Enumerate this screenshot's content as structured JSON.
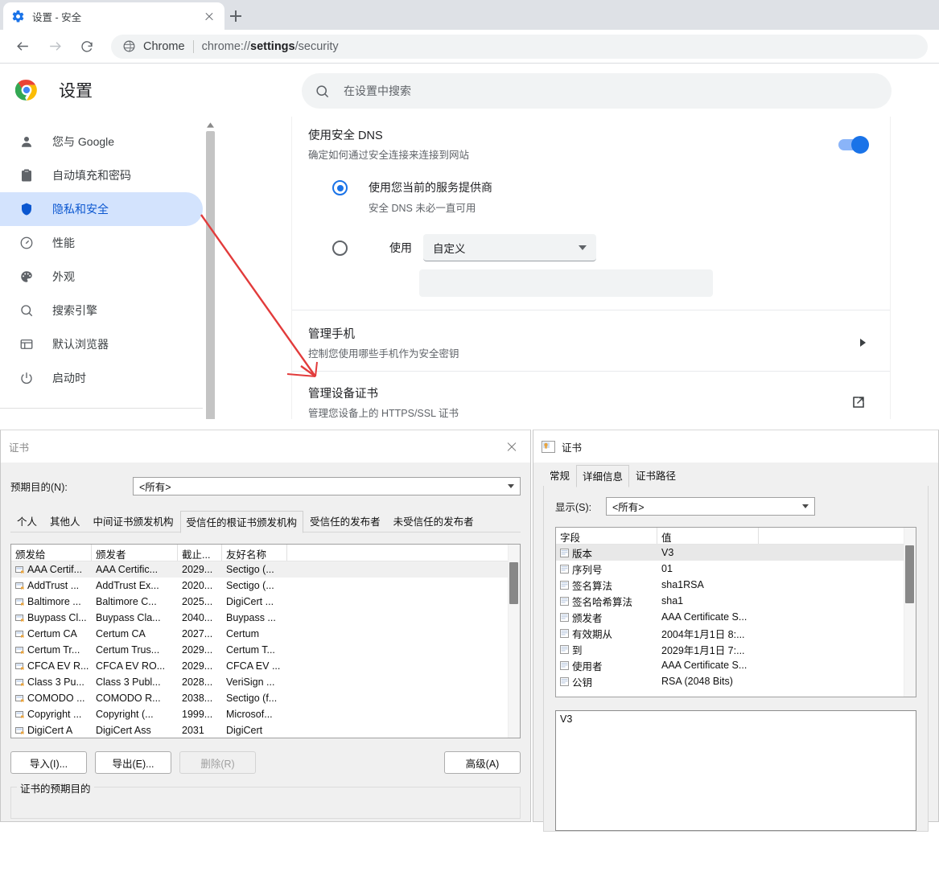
{
  "browser": {
    "tab": {
      "title": "设置 - 安全",
      "favicon_icon": "gear-icon",
      "close_icon": "close-icon"
    },
    "new_tab_label": "+",
    "back_icon": "back-arrow-icon",
    "forward_icon": "forward-arrow-icon",
    "reload_icon": "reload-icon",
    "omnibox": {
      "site_icon": "chrome-shield-icon",
      "brand": "Chrome",
      "url_prefix": "chrome://",
      "url_bold": "settings",
      "url_suffix": "/security"
    }
  },
  "settings": {
    "logo_icon": "chrome-logo-icon",
    "title": "设置",
    "search": {
      "icon": "search-icon",
      "placeholder": "在设置中搜索",
      "value": ""
    },
    "sidebar": {
      "items": [
        {
          "label": "您与 Google",
          "icon": "person-icon",
          "active": false
        },
        {
          "label": "自动填充和密码",
          "icon": "clipboard-icon",
          "active": false
        },
        {
          "label": "隐私和安全",
          "icon": "shield-icon",
          "active": true
        },
        {
          "label": "性能",
          "icon": "speedometer-icon",
          "active": false
        },
        {
          "label": "外观",
          "icon": "palette-icon",
          "active": false
        },
        {
          "label": "搜索引擎",
          "icon": "search-icon",
          "active": false
        },
        {
          "label": "默认浏览器",
          "icon": "browser-window-icon",
          "active": false
        },
        {
          "label": "启动时",
          "icon": "power-icon",
          "active": false
        }
      ]
    },
    "content": {
      "secure_dns": {
        "title": "使用安全 DNS",
        "subtitle": "确定如何通过安全连接来连接到网站",
        "toggle_on": true,
        "option_current": {
          "label": "使用您当前的服务提供商",
          "sublabel": "安全 DNS 未必一直可用",
          "selected": true
        },
        "option_custom": {
          "prefix": "使用",
          "select_value": "自定义",
          "input_value": "",
          "selected": false
        }
      },
      "manage_phones": {
        "title": "管理手机",
        "subtitle": "控制您使用哪些手机作为安全密钥",
        "action_icon": "chevron-right-icon"
      },
      "manage_device_certs": {
        "title": "管理设备证书",
        "subtitle": "管理您设备上的 HTTPS/SSL 证书",
        "action_icon": "external-link-icon"
      }
    },
    "annotation": {
      "type": "red-arrow",
      "color": "#e23b3b"
    }
  },
  "cert_manager": {
    "window_title": "证书",
    "close_icon": "close-icon",
    "purpose": {
      "label": "预期目的(N):",
      "value": "<所有>"
    },
    "tabs": [
      {
        "label": "个人",
        "selected": false
      },
      {
        "label": "其他人",
        "selected": false
      },
      {
        "label": "中间证书颁发机构",
        "selected": false
      },
      {
        "label": "受信任的根证书颁发机构",
        "selected": true
      },
      {
        "label": "受信任的发布者",
        "selected": false
      },
      {
        "label": "未受信任的发布者",
        "selected": false
      }
    ],
    "columns": [
      "颁发给",
      "颁发者",
      "截止...",
      "友好名称"
    ],
    "rows": [
      {
        "issued_to": "AAA Certif...",
        "issued_by": "AAA Certific...",
        "expiry": "2029...",
        "friendly": "Sectigo (...",
        "selected": true
      },
      {
        "issued_to": "AddTrust ...",
        "issued_by": "AddTrust Ex...",
        "expiry": "2020...",
        "friendly": "Sectigo (...",
        "selected": false
      },
      {
        "issued_to": "Baltimore ...",
        "issued_by": "Baltimore C...",
        "expiry": "2025...",
        "friendly": "DigiCert ...",
        "selected": false
      },
      {
        "issued_to": "Buypass Cl...",
        "issued_by": "Buypass Cla...",
        "expiry": "2040...",
        "friendly": "Buypass ...",
        "selected": false
      },
      {
        "issued_to": "Certum CA",
        "issued_by": "Certum CA",
        "expiry": "2027...",
        "friendly": "Certum",
        "selected": false
      },
      {
        "issued_to": "Certum Tr...",
        "issued_by": "Certum Trus...",
        "expiry": "2029...",
        "friendly": "Certum T...",
        "selected": false
      },
      {
        "issued_to": "CFCA EV R...",
        "issued_by": "CFCA EV RO...",
        "expiry": "2029...",
        "friendly": "CFCA EV ...",
        "selected": false
      },
      {
        "issued_to": "Class 3 Pu...",
        "issued_by": "Class 3 Publ...",
        "expiry": "2028...",
        "friendly": "VeriSign ...",
        "selected": false
      },
      {
        "issued_to": "COMODO ...",
        "issued_by": "COMODO R...",
        "expiry": "2038...",
        "friendly": "Sectigo (f...",
        "selected": false
      },
      {
        "issued_to": "Copyright ...",
        "issued_by": "Copyright (...",
        "expiry": "1999...",
        "friendly": "Microsof...",
        "selected": false
      },
      {
        "issued_to": "DigiCert A",
        "issued_by": "DigiCert Ass",
        "expiry": "2031",
        "friendly": "DigiCert",
        "selected": false
      }
    ],
    "buttons": {
      "import": "导入(I)...",
      "export": "导出(E)...",
      "remove": "删除(R)",
      "remove_disabled": true,
      "advanced": "高级(A)"
    },
    "group_legend": "证书的预期目的"
  },
  "cert_details": {
    "window_title": "证书",
    "title_icon": "certificate-icon",
    "tabs": [
      {
        "label": "常规",
        "selected": false
      },
      {
        "label": "详细信息",
        "selected": true
      },
      {
        "label": "证书路径",
        "selected": false
      }
    ],
    "show": {
      "label": "显示(S):",
      "value": "<所有>"
    },
    "columns": [
      "字段",
      "值"
    ],
    "rows": [
      {
        "field": "版本",
        "value": "V3",
        "selected": true
      },
      {
        "field": "序列号",
        "value": "01",
        "selected": false
      },
      {
        "field": "签名算法",
        "value": "sha1RSA",
        "selected": false
      },
      {
        "field": "签名哈希算法",
        "value": "sha1",
        "selected": false
      },
      {
        "field": "颁发者",
        "value": "AAA Certificate S...",
        "selected": false
      },
      {
        "field": "有效期从",
        "value": "2004年1月1日 8:...",
        "selected": false
      },
      {
        "field": "到",
        "value": "2029年1月1日 7:...",
        "selected": false
      },
      {
        "field": "使用者",
        "value": "AAA Certificate S...",
        "selected": false
      },
      {
        "field": "公钥",
        "value": "RSA (2048 Bits)",
        "selected": false
      }
    ],
    "detail_text": "V3"
  }
}
